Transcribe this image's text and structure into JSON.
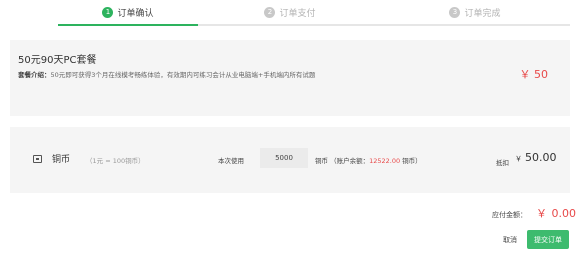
{
  "steps": [
    {
      "num": "1",
      "label": "订单确认"
    },
    {
      "num": "2",
      "label": "订单支付"
    },
    {
      "num": "3",
      "label": "订单完成"
    }
  ],
  "package": {
    "title": "50元90天PC套餐",
    "intro_label": "套餐介绍：",
    "intro_text": "50元即可获得3个月在线模考畅练体验，有效期内可练习会计从业电脑端+手机端内所有试题",
    "price": "￥ 50"
  },
  "coins": {
    "name": "铜币",
    "rate": "（1元 = 100铜币）",
    "use_label": "本次使用",
    "use_value": "5000",
    "unit": "铜币",
    "balance_prefix": "（账户余额：",
    "balance_amount": "12522.00",
    "balance_suffix": "铜币）",
    "deduct_label": "抵扣",
    "deduct_currency": "￥",
    "deduct_value": "50.00"
  },
  "payable": {
    "label": "应付金额：",
    "currency": "￥",
    "value": "0.00"
  },
  "actions": {
    "cancel": "取消",
    "submit": "提交订单"
  },
  "colors": {
    "accent": "#2db35e",
    "price": "#e84a4a",
    "panel": "#f5f5f5"
  }
}
